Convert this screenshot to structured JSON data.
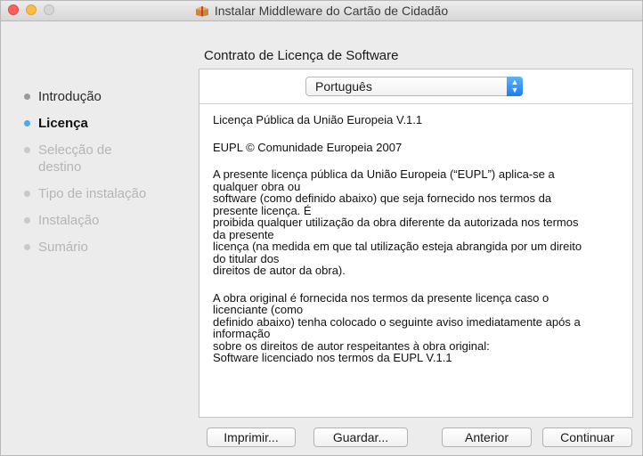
{
  "window": {
    "title": "Instalar Middleware do Cartão de Cidadão"
  },
  "sidebar": {
    "steps": [
      {
        "label": "Introdução",
        "state": "done"
      },
      {
        "label": "Licença",
        "state": "current"
      },
      {
        "label": "Selecção de destino",
        "state": "pending"
      },
      {
        "label": "Tipo de instalação",
        "state": "pending"
      },
      {
        "label": "Instalação",
        "state": "pending"
      },
      {
        "label": "Sumário",
        "state": "pending"
      }
    ]
  },
  "main": {
    "section_title": "Contrato de Licença de Software",
    "language_select": {
      "value": "Português"
    },
    "license": {
      "paragraphs": [
        [
          "Licença Pública da União Europeia V.1.1"
        ],
        [
          "EUPL © Comunidade Europeia 2007"
        ],
        [
          "A presente licença pública da União Europeia (“EUPL”) aplica-se a",
          "qualquer obra ou",
          "software (como definido abaixo) que seja fornecido nos termos da",
          "presente licença. É",
          "proibida qualquer utilização da obra diferente da autorizada nos termos",
          "da presente",
          "licença (na medida em que tal utilização esteja abrangida por um direito",
          "do titular dos",
          "direitos de autor da obra)."
        ],
        [
          "A obra original é fornecida nos termos da presente licença caso o",
          "licenciante (como",
          "definido abaixo) tenha colocado o seguinte aviso imediatamente após a",
          "informação",
          "sobre os direitos de autor respeitantes à obra original:",
          "Software licenciado nos termos da EUPL V.1.1"
        ]
      ]
    }
  },
  "buttons": {
    "print": "Imprimir...",
    "save": "Guardar...",
    "back": "Anterior",
    "continue": "Continuar"
  },
  "colors": {
    "current_step": "#4aa8f4",
    "select_stepper": "#1a7df0",
    "close": "#fc605c",
    "minimize": "#fdbc40"
  }
}
